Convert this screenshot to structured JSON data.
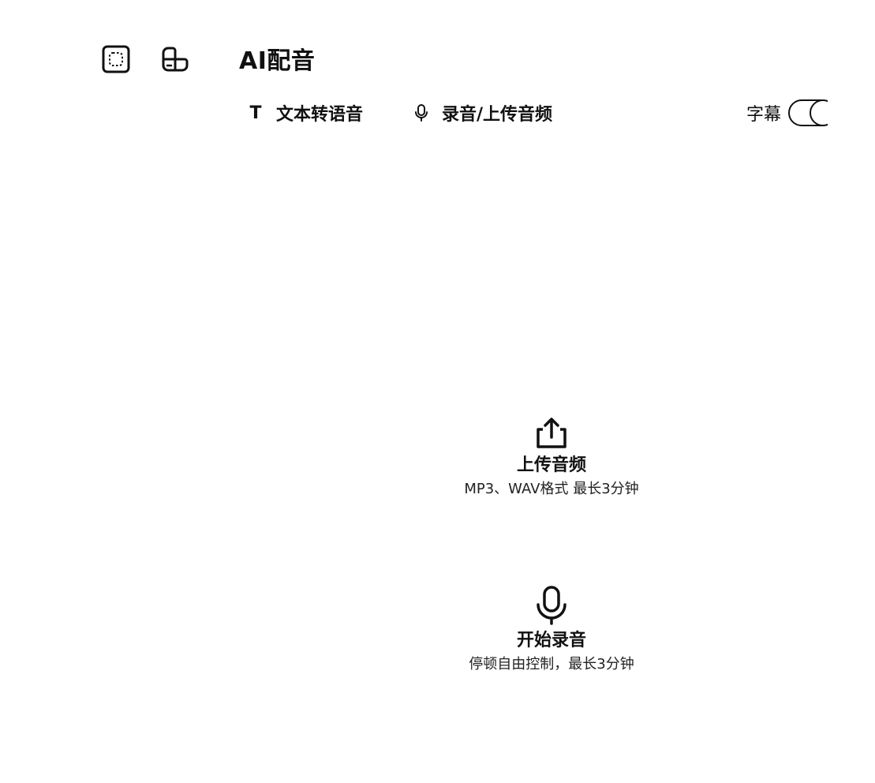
{
  "header": {
    "title": "AI配音",
    "left_icons": [
      "frame-icon",
      "layout-icon"
    ]
  },
  "tabs": [
    {
      "label": "文本转语音",
      "icon": "text-t-icon",
      "glyph": "T"
    },
    {
      "label": "录音/上传音频",
      "icon": "microphone-icon"
    }
  ],
  "subtitle_toggle": {
    "label": "字幕",
    "on": false
  },
  "options": {
    "upload": {
      "title": "上传音频",
      "description": "MP3、WAV格式 最长3分钟",
      "icon": "upload-icon"
    },
    "record": {
      "title": "开始录音",
      "description": "停顿自由控制，最长3分钟",
      "icon": "microphone-icon"
    }
  },
  "colors": {
    "text": "#111111",
    "background": "#ffffff"
  }
}
